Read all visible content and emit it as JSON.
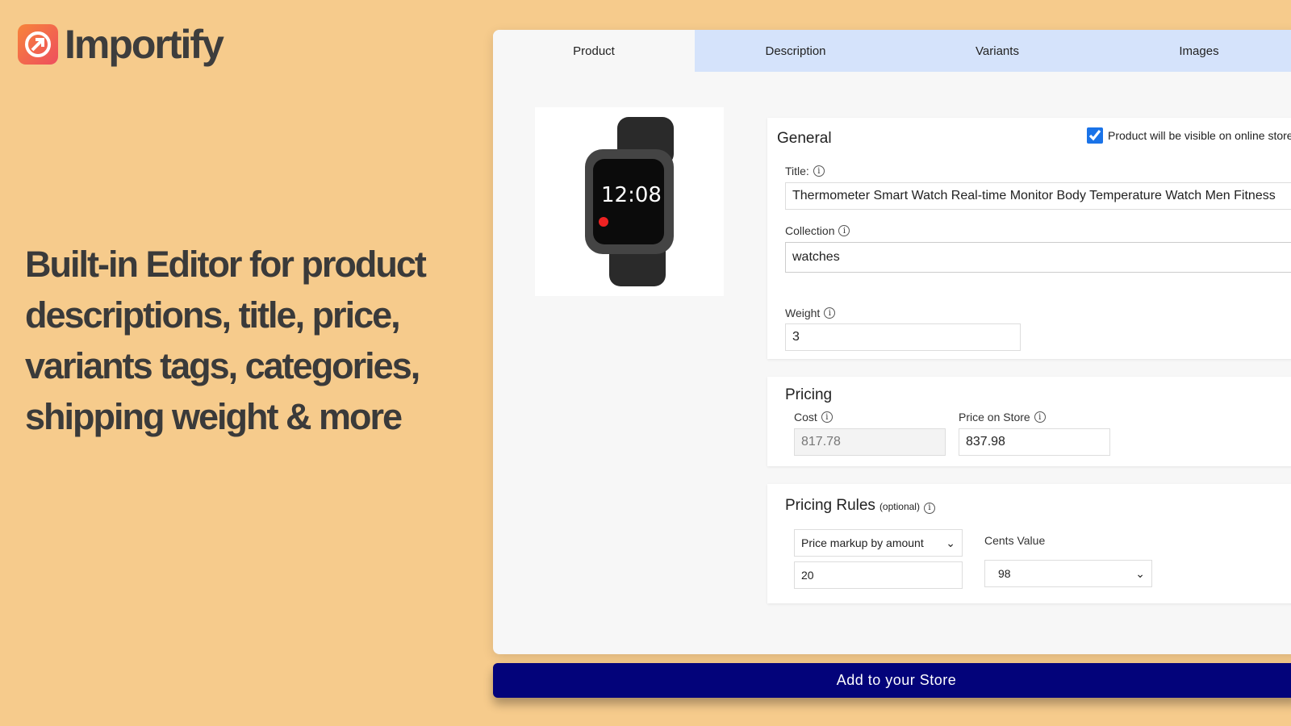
{
  "brand": {
    "name": "Importify",
    "accent": "#ee4e5e"
  },
  "headline": "Built-in Editor for product descriptions, title, price, variants tags, categories, shipping weight & more",
  "tabs": [
    {
      "label": "Product",
      "active": true
    },
    {
      "label": "Description"
    },
    {
      "label": "Variants"
    },
    {
      "label": "Images"
    }
  ],
  "general": {
    "heading": "General",
    "visible_checked": true,
    "visible_label": "Product will be visible on online store",
    "title_label": "Title:",
    "title_value": "Thermometer Smart Watch Real-time Monitor Body Temperature Watch Men Fitness",
    "collection_label": "Collection",
    "collection_value": "watches",
    "weight_label": "Weight",
    "weight_value": "3"
  },
  "pricing": {
    "heading": "Pricing",
    "cost_label": "Cost",
    "cost_value": "817.78",
    "price_label": "Price on Store",
    "price_value": "837.98"
  },
  "rules": {
    "heading": "Pricing Rules",
    "optional": "(optional)",
    "rule_type": "Price markup by amount",
    "amount": "20",
    "cents_label": "Cents Value",
    "cents_value": "98"
  },
  "add_button": "Add to your Store"
}
